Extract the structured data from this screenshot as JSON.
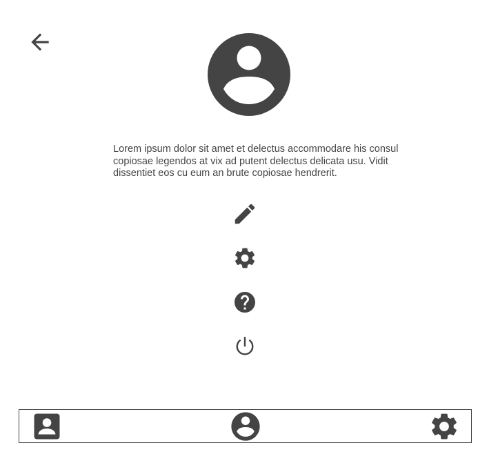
{
  "header": {
    "back_icon": "arrow-left-icon"
  },
  "profile": {
    "avatar_icon": "account-circle-icon",
    "bio": "Lorem ipsum dolor sit amet et delectus accommodare his consul copiosae legendos at vix ad putent delectus delicata usu. Vidit dissentiet eos cu eum an brute copiosae hendrerit."
  },
  "actions": [
    {
      "id": "edit",
      "icon": "pencil-icon"
    },
    {
      "id": "settings",
      "icon": "gear-icon"
    },
    {
      "id": "help",
      "icon": "help-circle-icon"
    },
    {
      "id": "logout",
      "icon": "power-icon"
    }
  ],
  "bottom_nav": [
    {
      "id": "contacts",
      "icon": "account-box-icon"
    },
    {
      "id": "profile",
      "icon": "account-circle-icon"
    },
    {
      "id": "settings",
      "icon": "gear-icon"
    }
  ],
  "colors": {
    "icon": "#444444",
    "text": "#444444",
    "background": "#ffffff"
  }
}
